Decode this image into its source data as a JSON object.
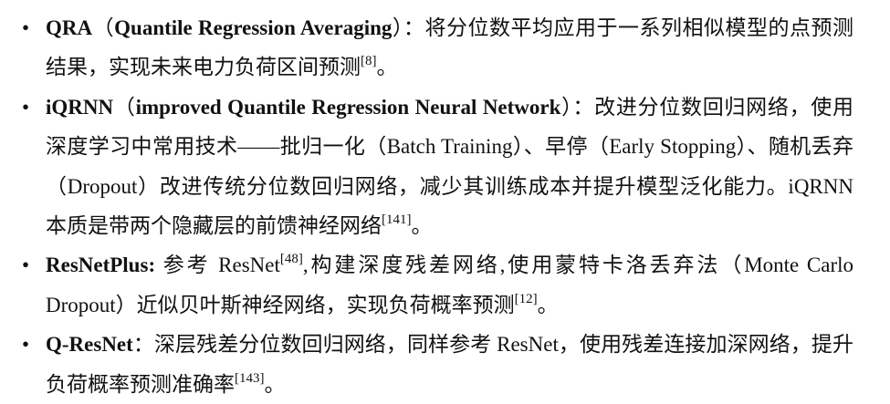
{
  "items": [
    {
      "bullet": "•",
      "term": "QRA",
      "lparen": "（",
      "full_name": "Quantile Regression Averaging",
      "rparen": "）",
      "sep": "：",
      "desc": "将分位数平均应用于一系列相似模型的点预测结果，实现未来电力负荷区间预测",
      "ref": "[8]",
      "end": "。"
    },
    {
      "bullet": "•",
      "term": "iQRNN",
      "lparen": "（",
      "full_name": "improved Quantile Regression Neural Network",
      "rparen": "）",
      "sep": "：",
      "desc": "改进分位数回归网络，使用深度学习中常用技术——批归一化（Batch Training）、早停（Early Stopping）、随机丢弃（Dropout）改进传统分位数回归网络，减少其训练成本并提升模型泛化能力。iQRNN 本质是带两个隐藏层的前馈神经网络",
      "ref": "[141]",
      "end": "。"
    },
    {
      "bullet": "•",
      "term": "ResNetPlus",
      "sep": ":",
      "desc_a": " 参考 ResNet",
      "ref_a": "[48]",
      "desc": ",构建深度残差网络,使用蒙特卡洛丢弃法（Monte Carlo Dropout）近似贝叶斯神经网络，实现负荷概率预测",
      "ref": "[12]",
      "end": "。"
    },
    {
      "bullet": "•",
      "term": "Q-ResNet",
      "sep": "：",
      "desc": "深层残差分位数回归网络，同样参考 ResNet，使用残差连接加深网络，提升负荷概率预测准确率",
      "ref": "[143]",
      "end": "。"
    }
  ]
}
